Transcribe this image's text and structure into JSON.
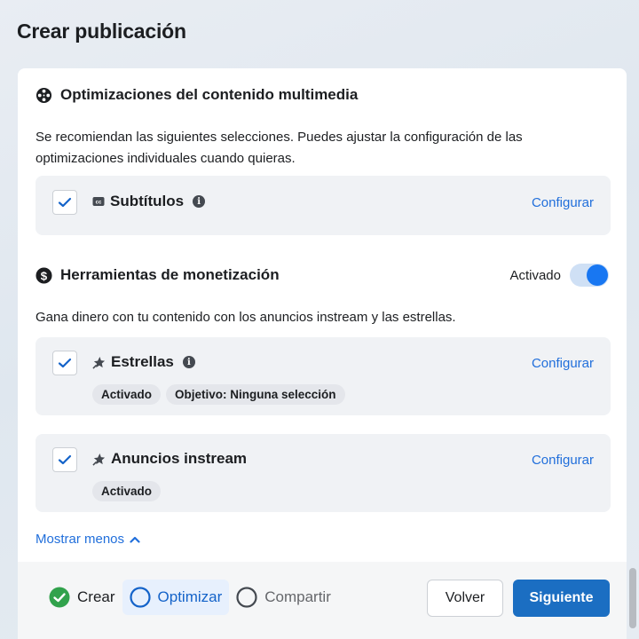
{
  "page": {
    "title": "Crear publicación"
  },
  "media": {
    "title": "Optimizaciones del contenido multimedia",
    "icon": "film-reel-icon",
    "description": "Se recomiendan las siguientes selecciones. Puedes ajustar la configuración de las optimizaciones individuales cuando quieras.",
    "option": {
      "label": "Subtítulos",
      "icon": "closed-captions-icon",
      "checked": true,
      "configure": "Configurar"
    }
  },
  "monetization": {
    "title": "Herramientas de monetización",
    "icon": "dollar-circle-icon",
    "toggle_label": "Activado",
    "toggle_on": true,
    "description": "Gana dinero con tu contenido con los anuncios instream y las estrellas.",
    "options": [
      {
        "label": "Estrellas",
        "icon": "star-burst-icon",
        "checked": true,
        "configure": "Configurar",
        "chips": [
          "Activado",
          "Objetivo: Ninguna selección"
        ]
      },
      {
        "label": "Anuncios instream",
        "icon": "star-burst-icon",
        "checked": true,
        "configure": "Configurar",
        "chips": [
          "Activado"
        ]
      }
    ],
    "show_less": "Mostrar menos"
  },
  "footer": {
    "steps": [
      {
        "label": "Crear",
        "state": "done"
      },
      {
        "label": "Optimizar",
        "state": "active"
      },
      {
        "label": "Compartir",
        "state": "todo"
      }
    ],
    "back": "Volver",
    "next": "Siguiente"
  },
  "colors": {
    "accent": "#1877f2",
    "link": "#216fdb",
    "done": "#31a24c",
    "button": "#1b6ec2"
  }
}
